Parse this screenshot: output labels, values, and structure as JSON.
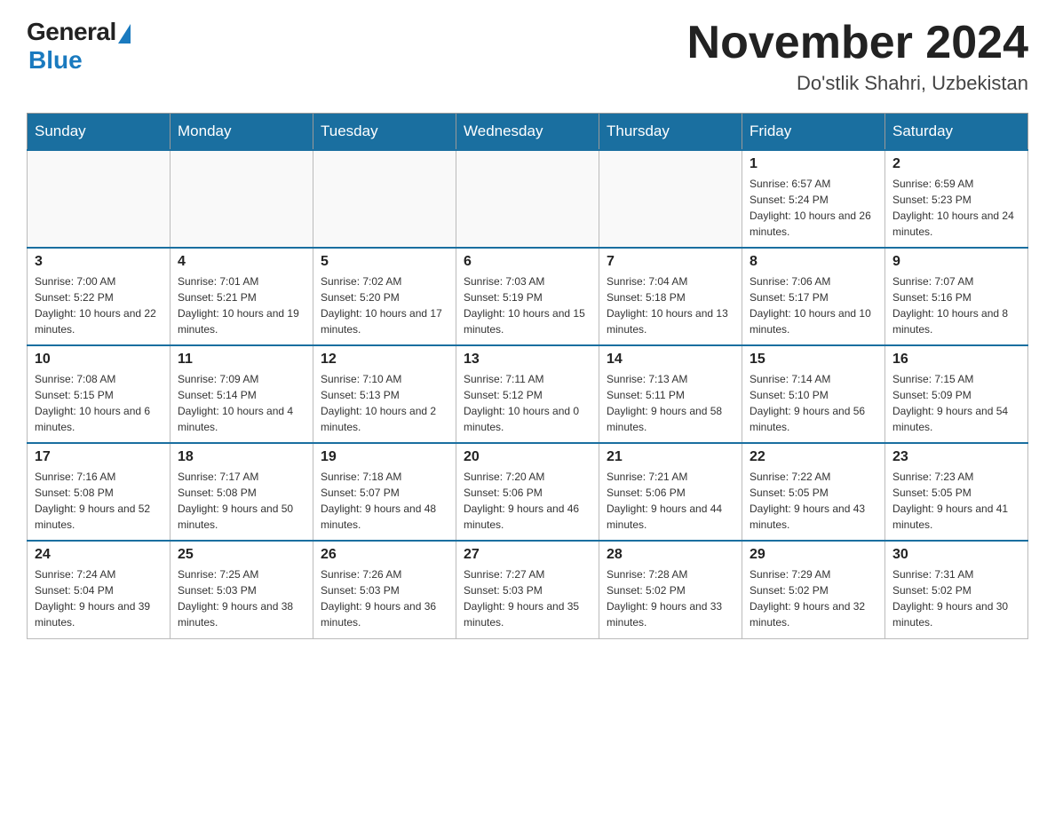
{
  "header": {
    "logo_general": "General",
    "logo_blue": "Blue",
    "month_title": "November 2024",
    "location": "Do'stlik Shahri, Uzbekistan"
  },
  "weekdays": [
    "Sunday",
    "Monday",
    "Tuesday",
    "Wednesday",
    "Thursday",
    "Friday",
    "Saturday"
  ],
  "weeks": [
    [
      {
        "day": "",
        "info": ""
      },
      {
        "day": "",
        "info": ""
      },
      {
        "day": "",
        "info": ""
      },
      {
        "day": "",
        "info": ""
      },
      {
        "day": "",
        "info": ""
      },
      {
        "day": "1",
        "info": "Sunrise: 6:57 AM\nSunset: 5:24 PM\nDaylight: 10 hours and 26 minutes."
      },
      {
        "day": "2",
        "info": "Sunrise: 6:59 AM\nSunset: 5:23 PM\nDaylight: 10 hours and 24 minutes."
      }
    ],
    [
      {
        "day": "3",
        "info": "Sunrise: 7:00 AM\nSunset: 5:22 PM\nDaylight: 10 hours and 22 minutes."
      },
      {
        "day": "4",
        "info": "Sunrise: 7:01 AM\nSunset: 5:21 PM\nDaylight: 10 hours and 19 minutes."
      },
      {
        "day": "5",
        "info": "Sunrise: 7:02 AM\nSunset: 5:20 PM\nDaylight: 10 hours and 17 minutes."
      },
      {
        "day": "6",
        "info": "Sunrise: 7:03 AM\nSunset: 5:19 PM\nDaylight: 10 hours and 15 minutes."
      },
      {
        "day": "7",
        "info": "Sunrise: 7:04 AM\nSunset: 5:18 PM\nDaylight: 10 hours and 13 minutes."
      },
      {
        "day": "8",
        "info": "Sunrise: 7:06 AM\nSunset: 5:17 PM\nDaylight: 10 hours and 10 minutes."
      },
      {
        "day": "9",
        "info": "Sunrise: 7:07 AM\nSunset: 5:16 PM\nDaylight: 10 hours and 8 minutes."
      }
    ],
    [
      {
        "day": "10",
        "info": "Sunrise: 7:08 AM\nSunset: 5:15 PM\nDaylight: 10 hours and 6 minutes."
      },
      {
        "day": "11",
        "info": "Sunrise: 7:09 AM\nSunset: 5:14 PM\nDaylight: 10 hours and 4 minutes."
      },
      {
        "day": "12",
        "info": "Sunrise: 7:10 AM\nSunset: 5:13 PM\nDaylight: 10 hours and 2 minutes."
      },
      {
        "day": "13",
        "info": "Sunrise: 7:11 AM\nSunset: 5:12 PM\nDaylight: 10 hours and 0 minutes."
      },
      {
        "day": "14",
        "info": "Sunrise: 7:13 AM\nSunset: 5:11 PM\nDaylight: 9 hours and 58 minutes."
      },
      {
        "day": "15",
        "info": "Sunrise: 7:14 AM\nSunset: 5:10 PM\nDaylight: 9 hours and 56 minutes."
      },
      {
        "day": "16",
        "info": "Sunrise: 7:15 AM\nSunset: 5:09 PM\nDaylight: 9 hours and 54 minutes."
      }
    ],
    [
      {
        "day": "17",
        "info": "Sunrise: 7:16 AM\nSunset: 5:08 PM\nDaylight: 9 hours and 52 minutes."
      },
      {
        "day": "18",
        "info": "Sunrise: 7:17 AM\nSunset: 5:08 PM\nDaylight: 9 hours and 50 minutes."
      },
      {
        "day": "19",
        "info": "Sunrise: 7:18 AM\nSunset: 5:07 PM\nDaylight: 9 hours and 48 minutes."
      },
      {
        "day": "20",
        "info": "Sunrise: 7:20 AM\nSunset: 5:06 PM\nDaylight: 9 hours and 46 minutes."
      },
      {
        "day": "21",
        "info": "Sunrise: 7:21 AM\nSunset: 5:06 PM\nDaylight: 9 hours and 44 minutes."
      },
      {
        "day": "22",
        "info": "Sunrise: 7:22 AM\nSunset: 5:05 PM\nDaylight: 9 hours and 43 minutes."
      },
      {
        "day": "23",
        "info": "Sunrise: 7:23 AM\nSunset: 5:05 PM\nDaylight: 9 hours and 41 minutes."
      }
    ],
    [
      {
        "day": "24",
        "info": "Sunrise: 7:24 AM\nSunset: 5:04 PM\nDaylight: 9 hours and 39 minutes."
      },
      {
        "day": "25",
        "info": "Sunrise: 7:25 AM\nSunset: 5:03 PM\nDaylight: 9 hours and 38 minutes."
      },
      {
        "day": "26",
        "info": "Sunrise: 7:26 AM\nSunset: 5:03 PM\nDaylight: 9 hours and 36 minutes."
      },
      {
        "day": "27",
        "info": "Sunrise: 7:27 AM\nSunset: 5:03 PM\nDaylight: 9 hours and 35 minutes."
      },
      {
        "day": "28",
        "info": "Sunrise: 7:28 AM\nSunset: 5:02 PM\nDaylight: 9 hours and 33 minutes."
      },
      {
        "day": "29",
        "info": "Sunrise: 7:29 AM\nSunset: 5:02 PM\nDaylight: 9 hours and 32 minutes."
      },
      {
        "day": "30",
        "info": "Sunrise: 7:31 AM\nSunset: 5:02 PM\nDaylight: 9 hours and 30 minutes."
      }
    ]
  ]
}
